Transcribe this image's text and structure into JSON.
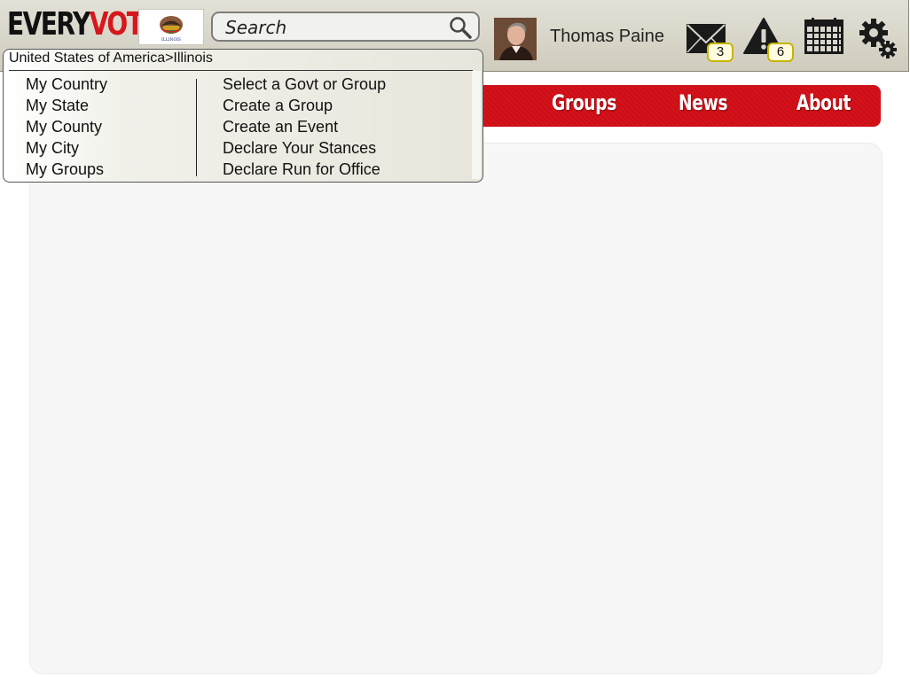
{
  "app": {
    "logo_every": "EVERY",
    "logo_vote": "VOTE",
    "flag_caption": "ILLINOIS"
  },
  "search": {
    "placeholder": "Search"
  },
  "user": {
    "name": "Thomas Paine"
  },
  "notifications": {
    "messages_count": "3",
    "alerts_count": "6"
  },
  "icons": {
    "search": "search-icon",
    "messages": "envelope-icon",
    "alerts": "warning-icon",
    "calendar": "calendar-icon",
    "settings": "gears-icon"
  },
  "nav": {
    "items": [
      {
        "label": "Groups"
      },
      {
        "label": "News"
      },
      {
        "label": "About"
      }
    ]
  },
  "dropdown": {
    "breadcrumb": "United States of America>Illinois",
    "left_items": [
      {
        "label": "My Country"
      },
      {
        "label": "My State"
      },
      {
        "label": "My County"
      },
      {
        "label": "My City"
      },
      {
        "label": "My Groups"
      }
    ],
    "right_items": [
      {
        "label": "Select a Govt or Group"
      },
      {
        "label": "Create a Group"
      },
      {
        "label": "Create an Event"
      },
      {
        "label": "Declare Your Stances"
      },
      {
        "label": "Declare Run for Office"
      }
    ]
  },
  "colors": {
    "brand_red": "#d4181b",
    "nav_red": "#d6121a",
    "badge_border": "#c8b400"
  }
}
